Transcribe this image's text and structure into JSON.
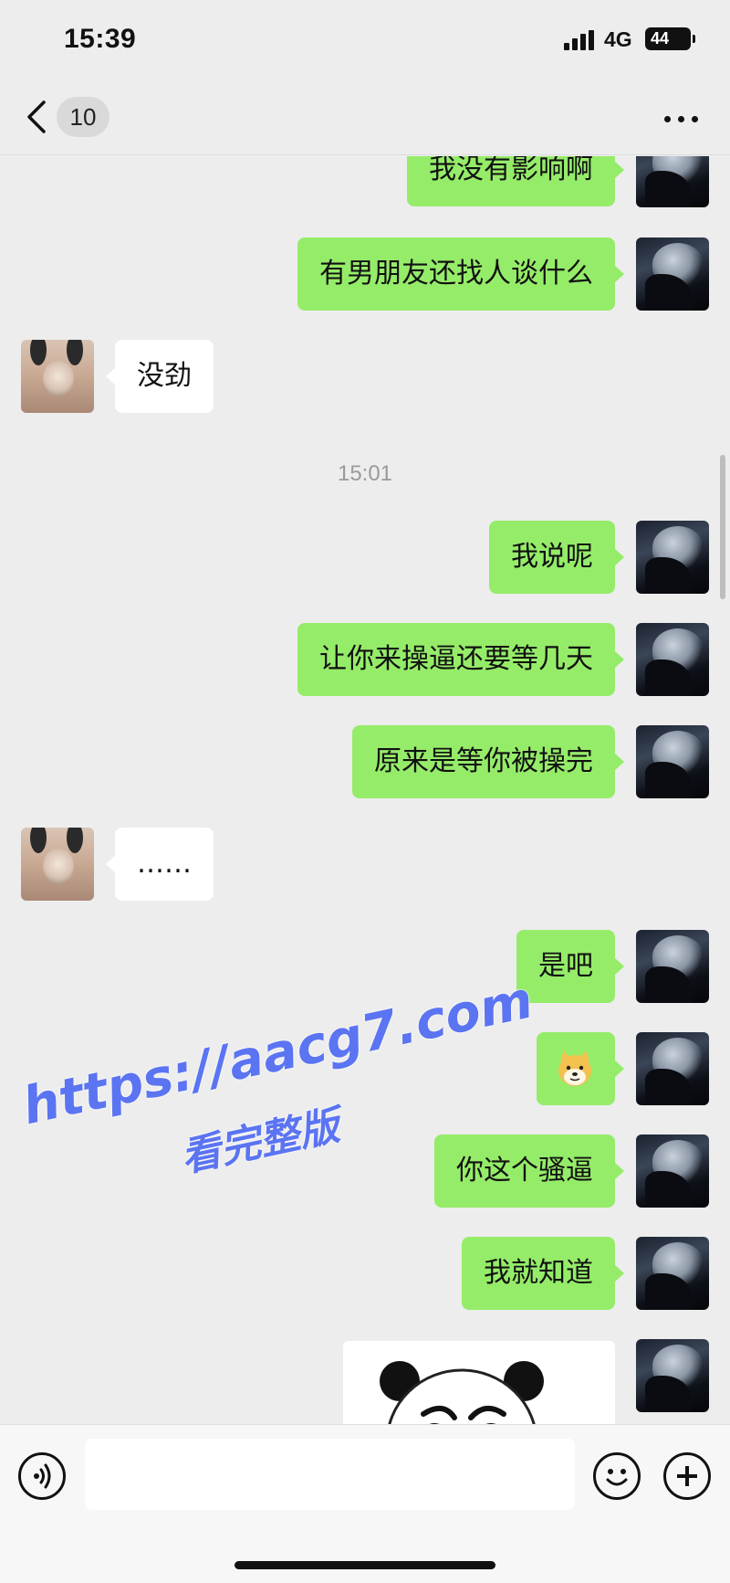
{
  "status_bar": {
    "time": "15:39",
    "network": "4G",
    "battery": "44",
    "battery_level": 0.44
  },
  "nav": {
    "unread_count": "10"
  },
  "messages": [
    {
      "side": "right",
      "text": "我没有影响啊"
    },
    {
      "side": "right",
      "text": "有男朋友还找人谈什么"
    },
    {
      "side": "left",
      "text": "没劲"
    },
    {
      "type": "time",
      "text": "15:01"
    },
    {
      "side": "right",
      "text": "我说呢"
    },
    {
      "side": "right",
      "text": "让你来操逼还要等几天"
    },
    {
      "side": "right",
      "text": "原来是等你被操完"
    },
    {
      "side": "left",
      "text": "……"
    },
    {
      "side": "right",
      "text": "是吧"
    },
    {
      "side": "right",
      "type": "emoji",
      "emoji": "doge-icon"
    },
    {
      "side": "right",
      "text": "你这个骚逼"
    },
    {
      "side": "right",
      "text": "我就知道"
    },
    {
      "side": "right",
      "type": "sticker",
      "sticker": "panda-face-sticker"
    }
  ],
  "watermark": {
    "url": "https://aacg7.com",
    "subtitle": "看完整版"
  },
  "input": {
    "value": "",
    "placeholder": ""
  },
  "colors": {
    "bubble_right": "#95ec69",
    "bubble_left": "#ffffff",
    "background": "#ededed",
    "watermark": "#5b74f2"
  }
}
